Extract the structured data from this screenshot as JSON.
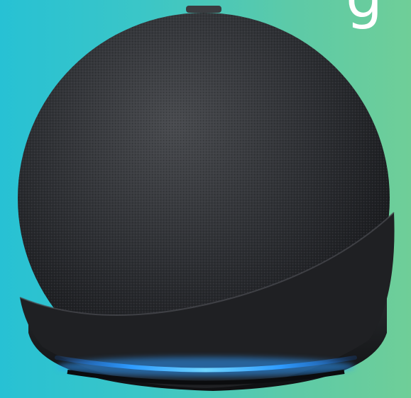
{
  "scene": {
    "subject": "smart-speaker",
    "colors": {
      "background_left": "#27c1d4",
      "background_right": "#6fce98",
      "speaker_fabric": "#2b2d30",
      "speaker_base": "#1c1d20",
      "light_ring": "#2e9bff"
    },
    "cropped_text": "g"
  }
}
